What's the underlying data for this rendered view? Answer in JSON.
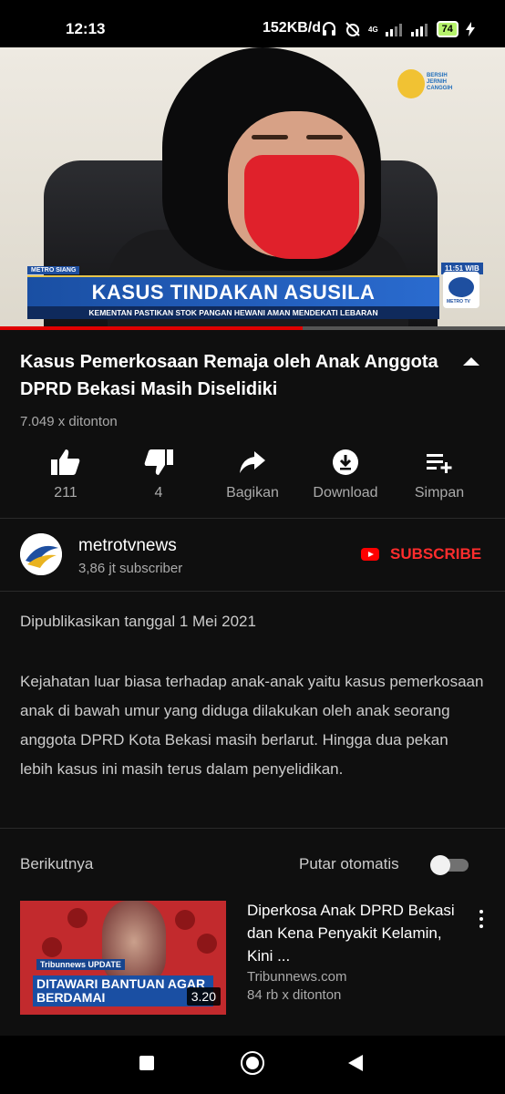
{
  "status_bar": {
    "time": "12:13",
    "speed": "152KB/d",
    "battery": "74",
    "network": "4G"
  },
  "video": {
    "headline": "KASUS TINDAKAN ASUSILA",
    "ticker": "KEMENTAN PASTIKAN STOK PANGAN HEWANI AMAN MENDEKATI LEBARAN",
    "show": "METRO SIANG",
    "clock": "11:51 WIB",
    "badge_text": "BERSIH JERNIH CANGGIH",
    "logo_text": "METRO TV",
    "progress": 0.6,
    "accent_color": "#e00000"
  },
  "title": "Kasus Pemerkosaan Remaja oleh Anak Anggota DPRD Bekasi Masih Diselidiki",
  "views": "7.049 x ditonton",
  "actions": {
    "like": "211",
    "dislike": "4",
    "share": "Bagikan",
    "download": "Download",
    "save": "Simpan"
  },
  "channel": {
    "name": "metrotvnews",
    "subscribers": "3,86 jt subscriber",
    "subscribe_label": "SUBSCRIBE"
  },
  "published": "Dipublikasikan tanggal 1 Mei 2021",
  "description": "Kejahatan luar biasa terhadap anak-anak yaitu kasus pemerkosaan anak di bawah umur yang diduga dilakukan oleh anak seorang anggota DPRD Kota Bekasi masih berlarut. Hingga dua pekan lebih kasus ini masih terus dalam penyelidikan.",
  "up_next": {
    "label": "Berikutnya",
    "autoplay_label": "Putar otomatis",
    "autoplay_on": false,
    "item": {
      "title": "Diperkosa Anak DPRD Bekasi dan Kena Penyakit Kelamin, Kini ...",
      "channel": "Tribunnews.com",
      "views": "84 rb x ditonton",
      "duration": "3.20",
      "thumb_caption": "DITAWARI BANTUAN AGAR BERDAMAI",
      "thumb_brand": "Tribunnews UPDATE"
    }
  },
  "icons": {
    "like": "thumb-up-icon",
    "dislike": "thumb-down-icon",
    "share": "share-icon",
    "download": "download-icon",
    "save": "playlist-add-icon"
  }
}
